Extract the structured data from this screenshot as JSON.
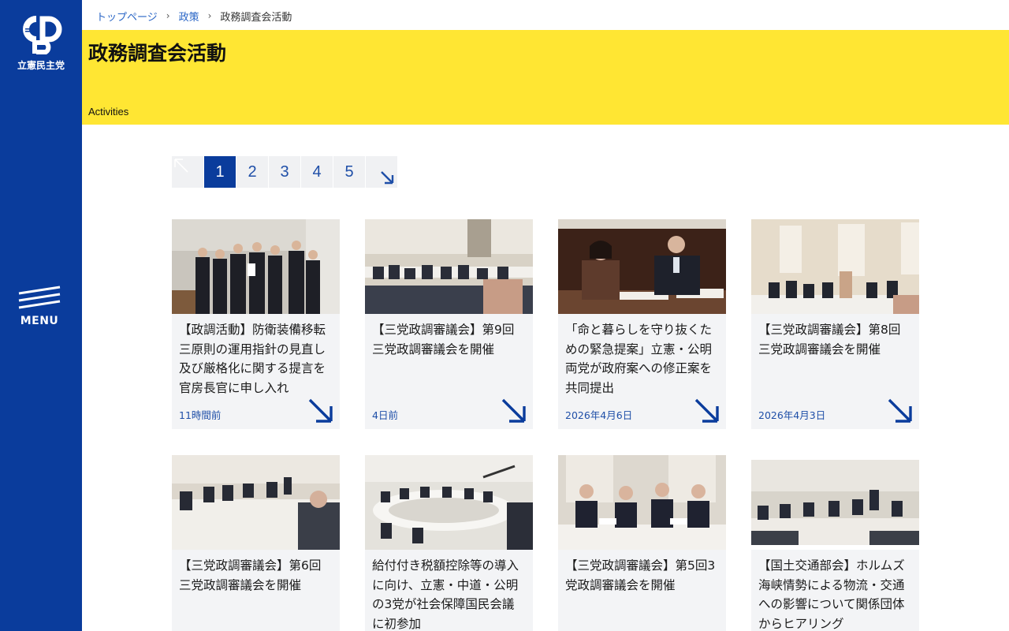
{
  "logo": {
    "mark": "CDP",
    "name": "立憲民主党"
  },
  "menu": {
    "label": "MENU"
  },
  "breadcrumb": {
    "home": "トップページ",
    "policy": "政策",
    "current": "政務調査会活動"
  },
  "header": {
    "title": "政務調査会活動",
    "subtitle": "Activities"
  },
  "pagination": {
    "pages": [
      "1",
      "2",
      "3",
      "4",
      "5"
    ],
    "current": "1"
  },
  "cards": [
    {
      "title": "【政調活動】防衛装備移転三原則の運用指針の見直し及び厳格化に関する提言を官房長官に申し入れ",
      "date": "11時間前"
    },
    {
      "title": "【三党政調審議会】第9回三党政調審議会を開催",
      "date": "4日前"
    },
    {
      "title": "「命と暮らしを守り抜くための緊急提案」立憲・公明両党が政府案への修正案を共同提出",
      "date": "2026年4月6日"
    },
    {
      "title": "【三党政調審議会】第8回三党政調審議会を開催",
      "date": "2026年4月3日"
    },
    {
      "title": "【三党政調審議会】第6回三党政調審議会を開催",
      "date": ""
    },
    {
      "title": "給付付き税額控除等の導入に向け、立憲・中道・公明の3党が社会保障国民会議に初参加",
      "date": ""
    },
    {
      "title": "【三党政調審議会】第5回3党政調審議会を開催",
      "date": ""
    },
    {
      "title": "【国土交通部会】ホルムズ海峡情勢による物流・交通への影響について関係団体からヒアリング",
      "date": ""
    }
  ],
  "colors": {
    "brand_blue": "#0a3c9c",
    "header_yellow": "#ffe633",
    "link_blue": "#2a66c6",
    "card_bg": "#f3f4f6"
  },
  "icons": {
    "first": "arrow-up-left-icon",
    "next": "arrow-down-right-icon",
    "card": "arrow-down-right-icon",
    "menu": "hamburger-icon"
  }
}
